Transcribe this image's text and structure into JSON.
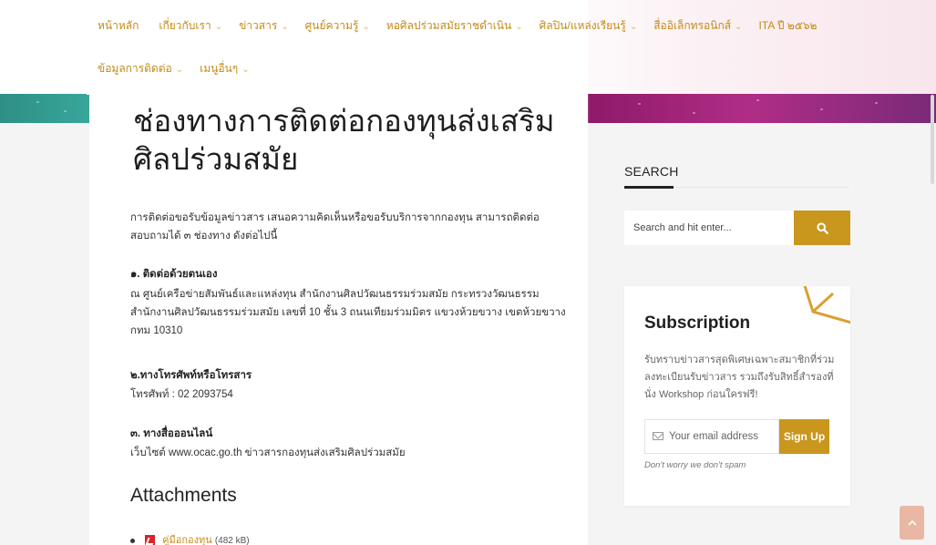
{
  "nav": {
    "row1": [
      {
        "label": "หน้าหลัก",
        "chevron": false
      },
      {
        "label": "เกี่ยวกับเรา",
        "chevron": true
      },
      {
        "label": "ข่าวสาร",
        "chevron": true
      },
      {
        "label": "ศูนย์ความรู้",
        "chevron": true
      },
      {
        "label": "หอศิลปร่วมสมัยราชดำเนิน",
        "chevron": true
      },
      {
        "label": "ศิลปิน/แหล่งเรียนรู้",
        "chevron": true
      },
      {
        "label": "สื่ออิเล็กทรอนิกส์",
        "chevron": true
      },
      {
        "label": "ITA ปี ๒๕๖๒",
        "chevron": false
      }
    ],
    "row2": [
      {
        "label": "ข้อมูลการติดต่อ",
        "chevron": true
      },
      {
        "label": "เมนูอื่นๆ",
        "chevron": true
      }
    ],
    "chevron_glyph": "⌄"
  },
  "article": {
    "title": "ช่องทางการติดต่อกองทุนส่งเสริมศิลปร่วมสมัย",
    "intro": "การติดต่อขอรับข้อมูลข่าวสาร เสนอความคิดเห็นหรือขอรับบริการจากกองทุน สามารถติดต่อสอบถามได้ ๓ ช่องทาง ดังต่อไปนี้",
    "sections": [
      {
        "heading": "๑. ติดต่อด้วยตนเอง",
        "body": "ณ ศูนย์เครือข่ายสัมพันธ์และแหล่งทุน สำนักงานศิลปวัฒนธรรมร่วมสมัย กระทรวงวัฒนธรรม สำนักงานศิลปวัฒนธรรมร่วมสมัย เลขที่ 10 ชั้น 3 ถนนเทียมร่วมมิตร แขวงห้วยขวาง เขตห้วยขวาง กทม 10310"
      },
      {
        "heading": "๒.ทางโทรศัพท์หรือโทรสาร",
        "body": "โทรศัพท์ : 02 2093754"
      },
      {
        "heading": "๓. ทางสื่อออนไลน์",
        "body": "เว็บไซต์ www.ocac.go.th ข่าวสารกองทุนส่งเสริมศิลปร่วมสมัย"
      }
    ],
    "attachments_title": "Attachments",
    "attachments": [
      {
        "name": "คู่มือกองทุน",
        "size": "(482 kB)"
      }
    ]
  },
  "sidebar": {
    "search_label": "SEARCH",
    "search_placeholder": "Search and hit enter...",
    "search_icon": "search-icon",
    "subscription": {
      "title": "Subscription",
      "text": "รับทราบข่าวสารสุดพิเศษเฉพาะสมาชิกที่ร่วมลงทะเบียนรับข่าวสาร รวมถึงรับสิทธิ์สำรองที่นั่ง Workshop ก่อนใครฟรี!",
      "email_placeholder": "Your email address",
      "signup_label": "Sign Up",
      "note": "Don't worry we don't spam"
    }
  },
  "colors": {
    "accent": "#c9961e",
    "nav_text": "#c48a1a",
    "back_to_top": "#e9b7a3"
  }
}
